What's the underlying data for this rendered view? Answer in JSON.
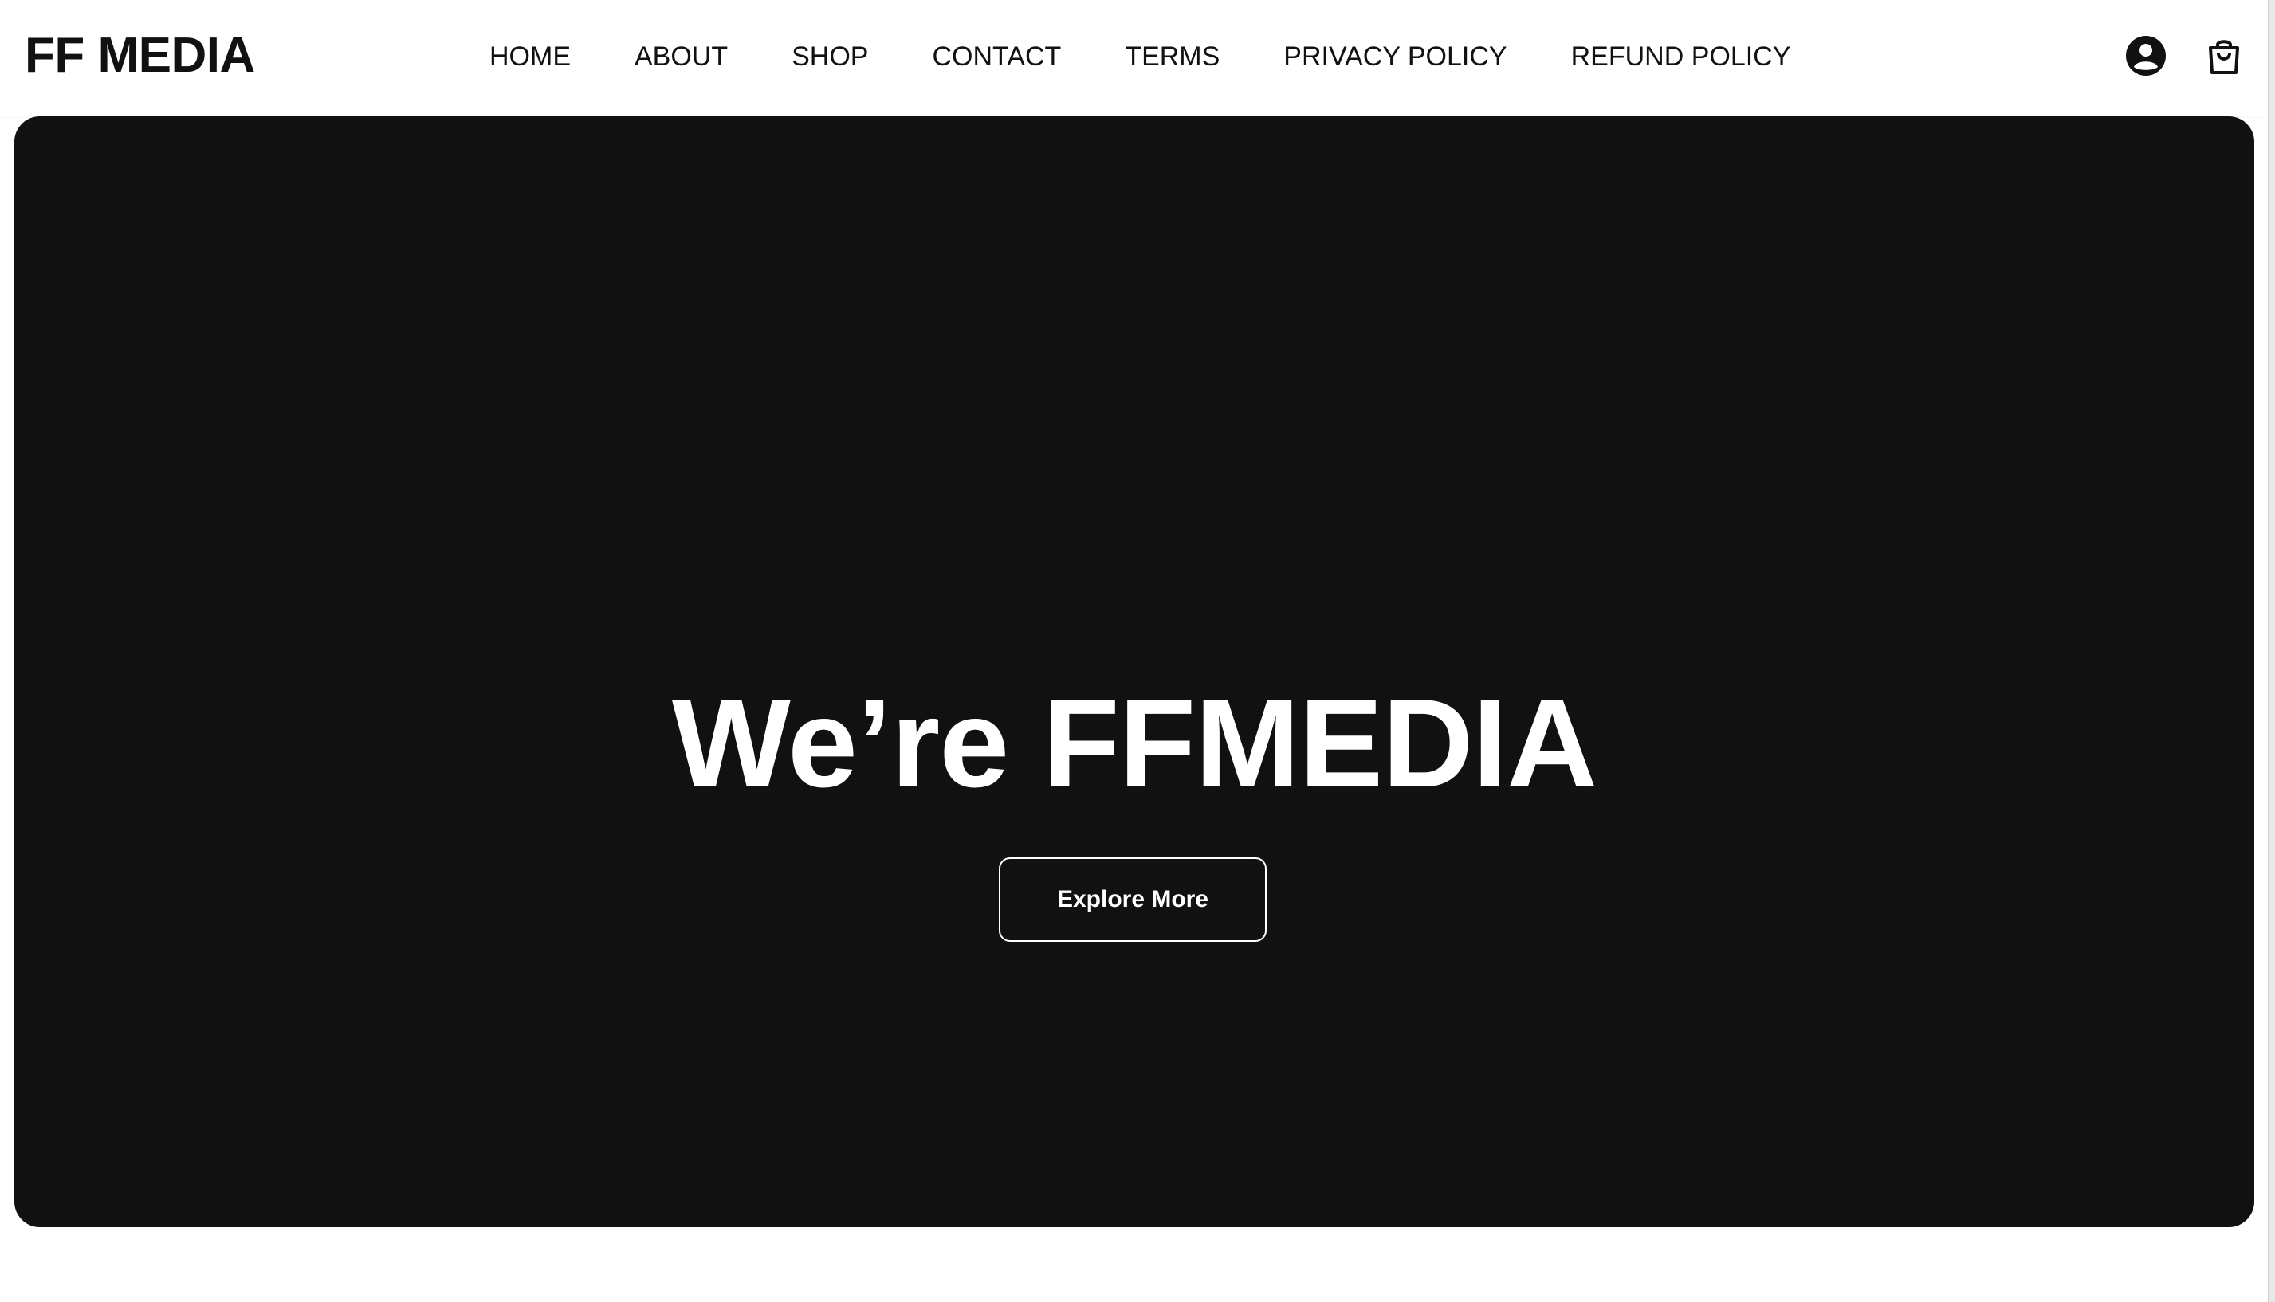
{
  "site": {
    "logo": "FF MEDIA"
  },
  "nav": {
    "items": [
      {
        "label": "HOME"
      },
      {
        "label": "ABOUT"
      },
      {
        "label": "SHOP"
      },
      {
        "label": "CONTACT"
      },
      {
        "label": "TERMS"
      },
      {
        "label": "PRIVACY POLICY"
      },
      {
        "label": "REFUND POLICY"
      }
    ]
  },
  "header_icons": {
    "account": "account-icon",
    "cart": "shopping-bag-icon"
  },
  "hero": {
    "title": "We’re FFMEDIA",
    "cta_label": "Explore More",
    "background": "#111111"
  },
  "colors": {
    "text": "#111111",
    "hero_text": "#ffffff"
  }
}
